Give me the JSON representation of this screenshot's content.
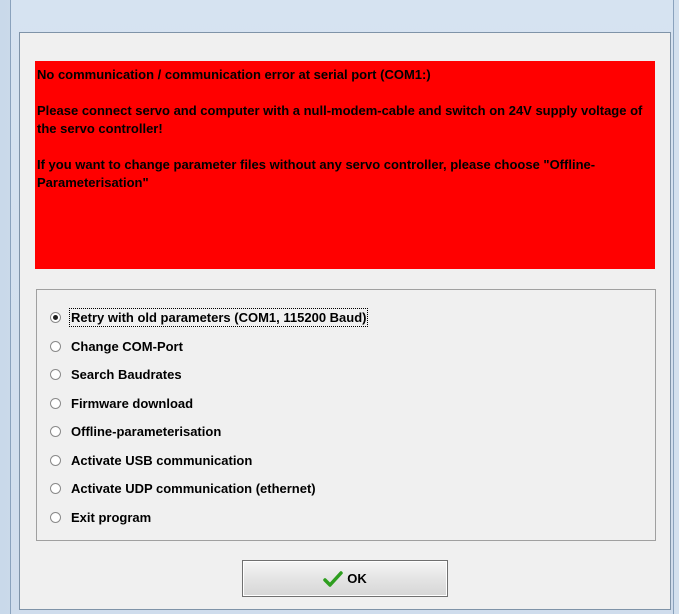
{
  "error": {
    "line1": "No communication / communication error at serial port (COM1:)",
    "line2": "Please connect servo and computer with a null-modem-cable and switch on 24V supply voltage of the servo controller!",
    "line3": "If you want to change parameter files without any servo controller, please choose \"Offline-Parameterisation\""
  },
  "options": [
    {
      "label": "Retry with old parameters (COM1, 115200 Baud)",
      "selected": true
    },
    {
      "label": "Change COM-Port",
      "selected": false
    },
    {
      "label": "Search Baudrates",
      "selected": false
    },
    {
      "label": "Firmware download",
      "selected": false
    },
    {
      "label": "Offline-parameterisation",
      "selected": false
    },
    {
      "label": "Activate USB communication",
      "selected": false
    },
    {
      "label": "Activate UDP communication (ethernet)",
      "selected": false
    },
    {
      "label": "Exit program",
      "selected": false
    }
  ],
  "ok_button": {
    "label": "OK",
    "icon": "check-icon"
  },
  "colors": {
    "error_background": "#ff0000",
    "check_icon": "#2e9e1f"
  }
}
